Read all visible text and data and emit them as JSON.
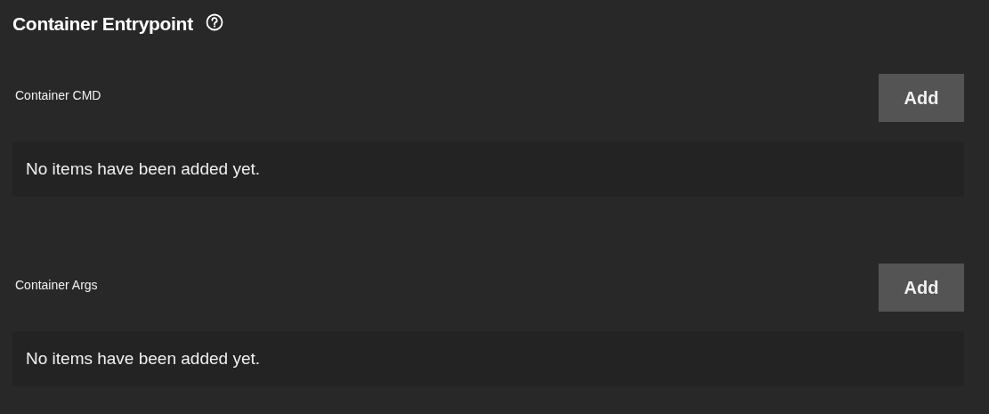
{
  "title": "Container Entrypoint",
  "sections": [
    {
      "label": "Container CMD",
      "button": "Add",
      "empty_message": "No items have been added yet."
    },
    {
      "label": "Container Args",
      "button": "Add",
      "empty_message": "No items have been added yet."
    }
  ]
}
